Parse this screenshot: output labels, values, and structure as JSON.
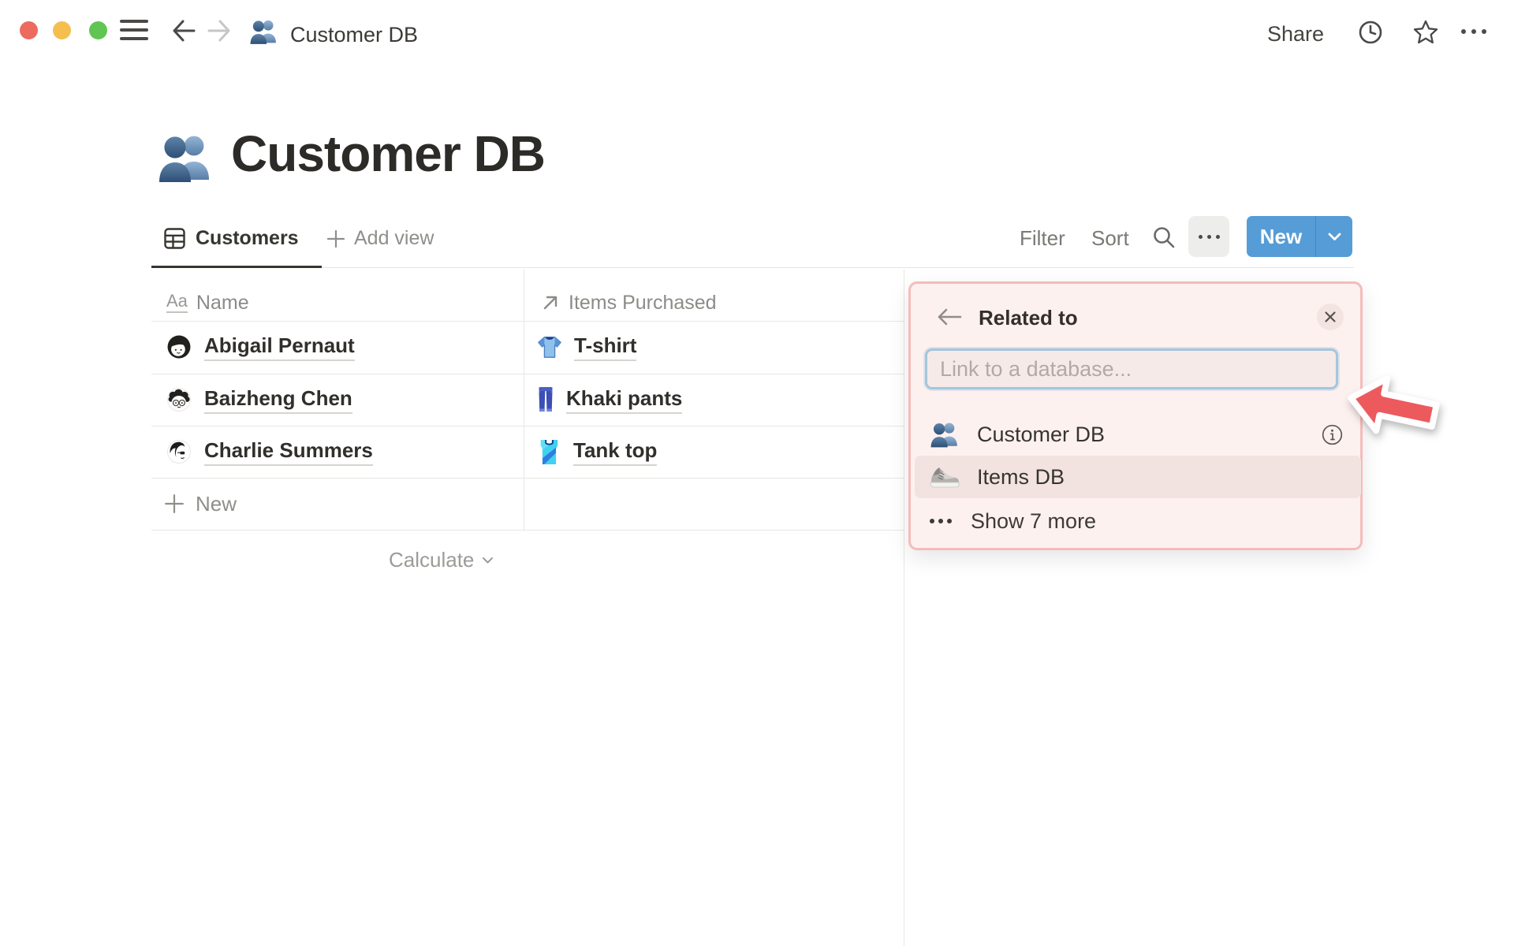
{
  "topbar": {
    "breadcrumb": "Customer DB",
    "share_label": "Share"
  },
  "page": {
    "title": "Customer DB",
    "tabs": {
      "active_tab": "Customers",
      "add_view": "Add view"
    },
    "toolbar": {
      "filter": "Filter",
      "sort": "Sort",
      "new_button": "New"
    },
    "table": {
      "columns": [
        {
          "label": "Name",
          "icon": "text-property-icon",
          "icon_text": "Aa"
        },
        {
          "label": "Items Purchased",
          "icon": "relation-arrow-icon"
        }
      ],
      "rows": [
        {
          "name": "Abigail Pernaut",
          "avatar": "avatar-woman-bob",
          "item": "T-shirt",
          "item_icon": "tshirt-icon"
        },
        {
          "name": "Baizheng Chen",
          "avatar": "avatar-man-glasses",
          "item": "Khaki pants",
          "item_icon": "jeans-icon"
        },
        {
          "name": "Charlie Summers",
          "avatar": "avatar-person-shades",
          "item": "Tank top",
          "item_icon": "tanktop-icon"
        }
      ],
      "new_row_label": "New",
      "calculate_label": "Calculate"
    },
    "popup": {
      "title": "Related to",
      "search_placeholder": "Link to a database...",
      "options": [
        {
          "label": "Customer DB",
          "icon": "people-icon",
          "has_info": true,
          "highlighted": false
        },
        {
          "label": "Items DB",
          "icon": "sneaker-icon",
          "has_info": false,
          "highlighted": true
        }
      ],
      "show_more_label": "Show 7 more"
    }
  },
  "colors": {
    "accent_blue": "#569cd6",
    "popup_bg": "#fdf1ef",
    "popup_border": "#f5bcba",
    "highlight_row": "#f2e3e1",
    "annotation_red": "#ec5a5e",
    "traffic_red": "#ed6a5e",
    "traffic_yellow": "#f4bf4f",
    "traffic_green": "#61c554",
    "text_dark": "#37352f",
    "text_gray": "#8d8b87"
  }
}
